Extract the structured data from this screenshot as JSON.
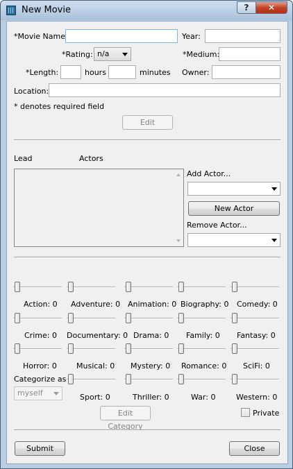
{
  "window": {
    "title": "New Movie",
    "help_glyph": "?",
    "close_glyph": "✕"
  },
  "form": {
    "movie_name_label": "*Movie Name:",
    "movie_name_value": "",
    "year_label": "Year:",
    "year_value": "",
    "rating_label": "*Rating:",
    "rating_value": "n/a",
    "medium_label": "*Medium:",
    "medium_value": "",
    "length_label": "*Length:",
    "hours_value": "",
    "hours_label": "hours",
    "minutes_value": "",
    "minutes_label": "minutes",
    "owner_label": "Owner:",
    "owner_value": "",
    "location_label": "Location:",
    "location_value": "",
    "required_note": "* denotes required field",
    "edit_label": "Edit"
  },
  "actors": {
    "lead_header": "Lead",
    "actors_header": "Actors",
    "add_actor_label": "Add Actor...",
    "add_actor_value": "",
    "new_actor_label": "New Actor",
    "remove_actor_label": "Remove Actor...",
    "remove_actor_value": ""
  },
  "categories": [
    {
      "label": "Action: 0",
      "value": 0
    },
    {
      "label": "Adventure: 0",
      "value": 0
    },
    {
      "label": "Animation: 0",
      "value": 0
    },
    {
      "label": "Biography: 0",
      "value": 0
    },
    {
      "label": "Comedy: 0",
      "value": 0
    },
    {
      "label": "Crime: 0",
      "value": 0
    },
    {
      "label": "Documentary: 0",
      "value": 0
    },
    {
      "label": "Drama: 0",
      "value": 0
    },
    {
      "label": "Family: 0",
      "value": 0
    },
    {
      "label": "Fantasy: 0",
      "value": 0
    },
    {
      "label": "Horror: 0",
      "value": 0
    },
    {
      "label": "Musical: 0",
      "value": 0
    },
    {
      "label": "Mystery: 0",
      "value": 0
    },
    {
      "label": "Romance: 0",
      "value": 0
    },
    {
      "label": "SciFi: 0",
      "value": 0
    },
    {
      "label": "Sport: 0",
      "value": 0
    },
    {
      "label": "Thriller: 0",
      "value": 0
    },
    {
      "label": "War: 0",
      "value": 0
    },
    {
      "label": "Western: 0",
      "value": 0
    }
  ],
  "categorize": {
    "label": "Categorize as",
    "value": "myself",
    "edit_category_label": "Edit Category",
    "private_label": "Private",
    "private_checked": false
  },
  "footer": {
    "submit_label": "Submit",
    "close_label": "Close"
  }
}
